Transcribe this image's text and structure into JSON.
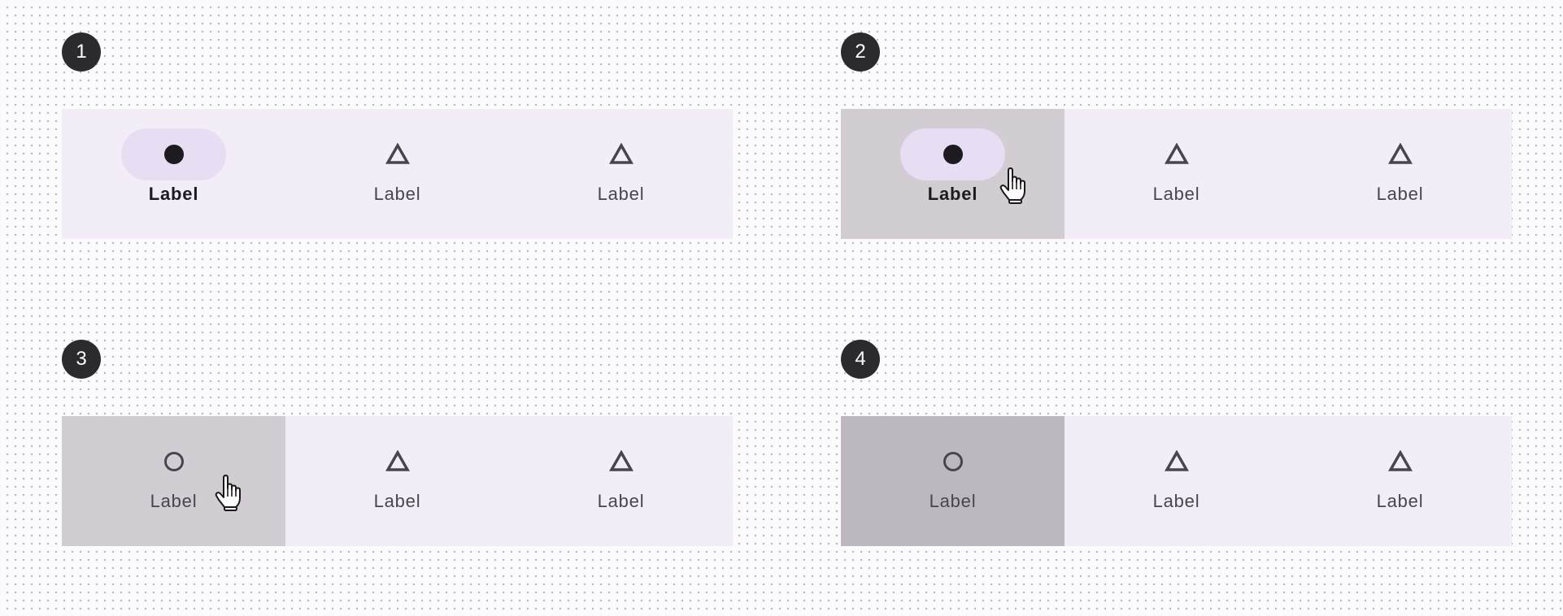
{
  "panels": [
    {
      "number": "1",
      "items": [
        {
          "label": "Label",
          "icon": "filled-circle-icon",
          "state": "selected"
        },
        {
          "label": "Label",
          "icon": "triangle-icon",
          "state": "default"
        },
        {
          "label": "Label",
          "icon": "triangle-icon",
          "state": "default"
        }
      ]
    },
    {
      "number": "2",
      "items": [
        {
          "label": "Label",
          "icon": "filled-circle-icon",
          "state": "selected-hover"
        },
        {
          "label": "Label",
          "icon": "triangle-icon",
          "state": "default"
        },
        {
          "label": "Label",
          "icon": "triangle-icon",
          "state": "default"
        }
      ]
    },
    {
      "number": "3",
      "items": [
        {
          "label": "Label",
          "icon": "circle-outline-icon",
          "state": "hover"
        },
        {
          "label": "Label",
          "icon": "triangle-icon",
          "state": "default"
        },
        {
          "label": "Label",
          "icon": "triangle-icon",
          "state": "default"
        }
      ]
    },
    {
      "number": "4",
      "items": [
        {
          "label": "Label",
          "icon": "circle-outline-icon",
          "state": "pressed"
        },
        {
          "label": "Label",
          "icon": "triangle-icon",
          "state": "default"
        },
        {
          "label": "Label",
          "icon": "triangle-icon",
          "state": "default"
        }
      ]
    }
  ],
  "colors": {
    "navbar_bg": "#f2edf6",
    "active_indicator": "#e8def4",
    "hover_bg": "#d2ccd3",
    "pressed_bg": "#bdb8bf",
    "badge_bg": "#2b2b2d",
    "icon": "#49454f",
    "active_icon": "#1d1b20"
  }
}
